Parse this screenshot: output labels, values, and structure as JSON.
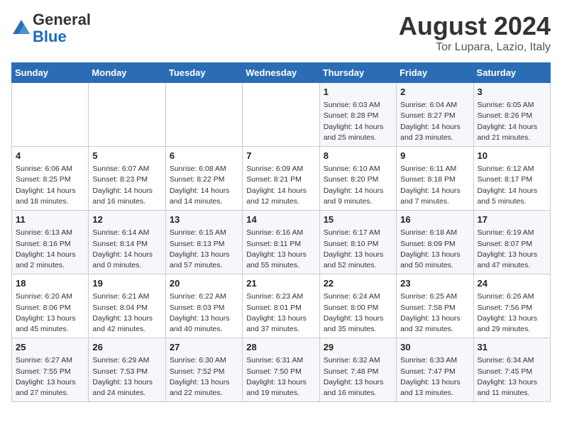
{
  "header": {
    "logo_line1": "General",
    "logo_line2": "Blue",
    "month": "August 2024",
    "location": "Tor Lupara, Lazio, Italy"
  },
  "weekdays": [
    "Sunday",
    "Monday",
    "Tuesday",
    "Wednesday",
    "Thursday",
    "Friday",
    "Saturday"
  ],
  "weeks": [
    [
      {
        "day": "",
        "info": ""
      },
      {
        "day": "",
        "info": ""
      },
      {
        "day": "",
        "info": ""
      },
      {
        "day": "",
        "info": ""
      },
      {
        "day": "1",
        "info": "Sunrise: 6:03 AM\nSunset: 8:28 PM\nDaylight: 14 hours and 25 minutes."
      },
      {
        "day": "2",
        "info": "Sunrise: 6:04 AM\nSunset: 8:27 PM\nDaylight: 14 hours and 23 minutes."
      },
      {
        "day": "3",
        "info": "Sunrise: 6:05 AM\nSunset: 8:26 PM\nDaylight: 14 hours and 21 minutes."
      }
    ],
    [
      {
        "day": "4",
        "info": "Sunrise: 6:06 AM\nSunset: 8:25 PM\nDaylight: 14 hours and 18 minutes."
      },
      {
        "day": "5",
        "info": "Sunrise: 6:07 AM\nSunset: 8:23 PM\nDaylight: 14 hours and 16 minutes."
      },
      {
        "day": "6",
        "info": "Sunrise: 6:08 AM\nSunset: 8:22 PM\nDaylight: 14 hours and 14 minutes."
      },
      {
        "day": "7",
        "info": "Sunrise: 6:09 AM\nSunset: 8:21 PM\nDaylight: 14 hours and 12 minutes."
      },
      {
        "day": "8",
        "info": "Sunrise: 6:10 AM\nSunset: 8:20 PM\nDaylight: 14 hours and 9 minutes."
      },
      {
        "day": "9",
        "info": "Sunrise: 6:11 AM\nSunset: 8:18 PM\nDaylight: 14 hours and 7 minutes."
      },
      {
        "day": "10",
        "info": "Sunrise: 6:12 AM\nSunset: 8:17 PM\nDaylight: 14 hours and 5 minutes."
      }
    ],
    [
      {
        "day": "11",
        "info": "Sunrise: 6:13 AM\nSunset: 8:16 PM\nDaylight: 14 hours and 2 minutes."
      },
      {
        "day": "12",
        "info": "Sunrise: 6:14 AM\nSunset: 8:14 PM\nDaylight: 14 hours and 0 minutes."
      },
      {
        "day": "13",
        "info": "Sunrise: 6:15 AM\nSunset: 8:13 PM\nDaylight: 13 hours and 57 minutes."
      },
      {
        "day": "14",
        "info": "Sunrise: 6:16 AM\nSunset: 8:11 PM\nDaylight: 13 hours and 55 minutes."
      },
      {
        "day": "15",
        "info": "Sunrise: 6:17 AM\nSunset: 8:10 PM\nDaylight: 13 hours and 52 minutes."
      },
      {
        "day": "16",
        "info": "Sunrise: 6:18 AM\nSunset: 8:09 PM\nDaylight: 13 hours and 50 minutes."
      },
      {
        "day": "17",
        "info": "Sunrise: 6:19 AM\nSunset: 8:07 PM\nDaylight: 13 hours and 47 minutes."
      }
    ],
    [
      {
        "day": "18",
        "info": "Sunrise: 6:20 AM\nSunset: 8:06 PM\nDaylight: 13 hours and 45 minutes."
      },
      {
        "day": "19",
        "info": "Sunrise: 6:21 AM\nSunset: 8:04 PM\nDaylight: 13 hours and 42 minutes."
      },
      {
        "day": "20",
        "info": "Sunrise: 6:22 AM\nSunset: 8:03 PM\nDaylight: 13 hours and 40 minutes."
      },
      {
        "day": "21",
        "info": "Sunrise: 6:23 AM\nSunset: 8:01 PM\nDaylight: 13 hours and 37 minutes."
      },
      {
        "day": "22",
        "info": "Sunrise: 6:24 AM\nSunset: 8:00 PM\nDaylight: 13 hours and 35 minutes."
      },
      {
        "day": "23",
        "info": "Sunrise: 6:25 AM\nSunset: 7:58 PM\nDaylight: 13 hours and 32 minutes."
      },
      {
        "day": "24",
        "info": "Sunrise: 6:26 AM\nSunset: 7:56 PM\nDaylight: 13 hours and 29 minutes."
      }
    ],
    [
      {
        "day": "25",
        "info": "Sunrise: 6:27 AM\nSunset: 7:55 PM\nDaylight: 13 hours and 27 minutes."
      },
      {
        "day": "26",
        "info": "Sunrise: 6:29 AM\nSunset: 7:53 PM\nDaylight: 13 hours and 24 minutes."
      },
      {
        "day": "27",
        "info": "Sunrise: 6:30 AM\nSunset: 7:52 PM\nDaylight: 13 hours and 22 minutes."
      },
      {
        "day": "28",
        "info": "Sunrise: 6:31 AM\nSunset: 7:50 PM\nDaylight: 13 hours and 19 minutes."
      },
      {
        "day": "29",
        "info": "Sunrise: 6:32 AM\nSunset: 7:48 PM\nDaylight: 13 hours and 16 minutes."
      },
      {
        "day": "30",
        "info": "Sunrise: 6:33 AM\nSunset: 7:47 PM\nDaylight: 13 hours and 13 minutes."
      },
      {
        "day": "31",
        "info": "Sunrise: 6:34 AM\nSunset: 7:45 PM\nDaylight: 13 hours and 11 minutes."
      }
    ]
  ]
}
